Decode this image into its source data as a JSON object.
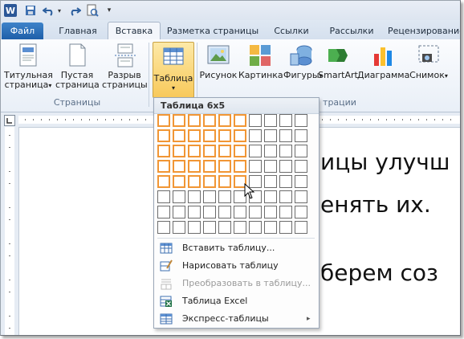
{
  "window": {
    "app_icon": "W"
  },
  "quick_access": {
    "more_label": "▾"
  },
  "tabs": [
    {
      "id": "file",
      "label": "Файл"
    },
    {
      "id": "home",
      "label": "Главная"
    },
    {
      "id": "insert",
      "label": "Вставка"
    },
    {
      "id": "layout",
      "label": "Разметка страницы"
    },
    {
      "id": "refs",
      "label": "Ссылки"
    },
    {
      "id": "mailings",
      "label": "Рассылки"
    },
    {
      "id": "review",
      "label": "Рецензирование"
    }
  ],
  "ribbon": {
    "pages_group": {
      "label": "Страницы",
      "cover": {
        "line1": "Титульная",
        "line2": "страница",
        "arrow": "▾"
      },
      "blank": {
        "line1": "Пустая",
        "line2": "страница"
      },
      "break": {
        "line1": "Разрыв",
        "line2": "страницы"
      }
    },
    "table": {
      "line1": "Таблица",
      "arrow": "▾"
    },
    "illustrations": {
      "label": "Иллюстрации",
      "picture": "Рисунок",
      "clipart": "Картинка",
      "shapes": {
        "line1": "Фигуры",
        "arrow": "▾"
      },
      "smartart": "SmartArt",
      "chart": "Диаграмма",
      "screenshot": {
        "line1": "Снимок",
        "arrow": "▾"
      }
    },
    "visible_group_label_fragment": "трации"
  },
  "document": {
    "line1": "ицы улучш",
    "line2": "енять их.",
    "line3": "берем соз"
  },
  "dropdown": {
    "title": "Таблица 6x5",
    "grid": {
      "cols": 10,
      "rows": 8,
      "selected_cols": 6,
      "selected_rows": 5
    },
    "items": [
      {
        "label": "Вставить таблицу...",
        "disabled": false,
        "icon": "insert-table-icon"
      },
      {
        "label": "Нарисовать таблицу",
        "disabled": false,
        "icon": "draw-table-icon"
      },
      {
        "label": "Преобразовать в таблицу...",
        "disabled": true,
        "icon": "convert-table-icon"
      },
      {
        "label": "Таблица Excel",
        "disabled": false,
        "icon": "excel-table-icon"
      },
      {
        "label": "Экспресс-таблицы",
        "disabled": false,
        "icon": "quick-tables-icon",
        "submenu": "▸"
      }
    ]
  },
  "colors": {
    "accent": "#f19635",
    "file_tab": "#2a6cb5",
    "ribbon_bg": "#e9eff7"
  }
}
